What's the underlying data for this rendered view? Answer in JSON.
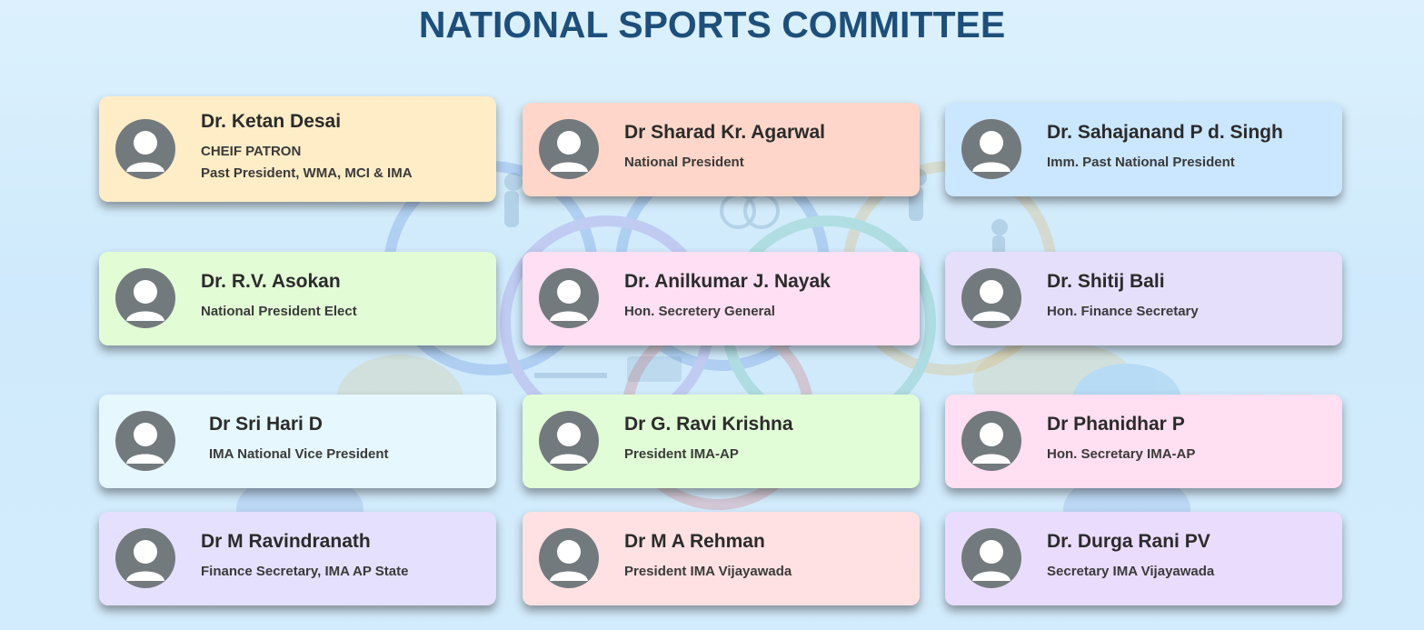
{
  "page": {
    "title": "NATIONAL SPORTS COMMITTEE"
  },
  "colors": {
    "title": "#1e4f7a",
    "avatar": "#737a7e",
    "background": "#d3ecfd"
  },
  "members": [
    {
      "name": "Dr. Ketan Desai",
      "roles": [
        "CHEIF PATRON",
        "Past President, WMA, MCI & IMA"
      ],
      "color": "#ffedc7"
    },
    {
      "name": "Dr Sharad Kr. Agarwal",
      "roles": [
        "National President"
      ],
      "color": "#ffd6c9"
    },
    {
      "name": "Dr. Sahajanand P d. Singh",
      "roles": [
        "Imm. Past National President"
      ],
      "color": "#cbe6ff"
    },
    {
      "name": "Dr. R.V. Asokan",
      "roles": [
        "National President Elect"
      ],
      "color": "#e2fcd6"
    },
    {
      "name": "Dr. Anilkumar J. Nayak",
      "roles": [
        "Hon. Secretery General"
      ],
      "color": "#ffdff3"
    },
    {
      "name": "Dr. Shitij Bali",
      "roles": [
        "Hon. Finance Secretary"
      ],
      "color": "#e6dffc"
    },
    {
      "name": "Dr Sri Hari D",
      "roles": [
        "IMA National Vice President"
      ],
      "color": "#e6f7fd"
    },
    {
      "name": "Dr G. Ravi Krishna",
      "roles": [
        "President IMA-AP"
      ],
      "color": "#e1fdd7"
    },
    {
      "name": "Dr Phanidhar P",
      "roles": [
        "Hon. Secretary IMA-AP"
      ],
      "color": "#ffdff1"
    },
    {
      "name": "Dr M Ravindranath",
      "roles": [
        "Finance Secretary, IMA AP State"
      ],
      "color": "#e5e0fd"
    },
    {
      "name": "Dr M A Rehman",
      "roles": [
        "President IMA Vijayawada"
      ],
      "color": "#ffe1e3"
    },
    {
      "name": "Dr. Durga Rani PV",
      "roles": [
        "Secretary IMA Vijayawada"
      ],
      "color": "#eadcfd"
    }
  ],
  "icons": {
    "avatar": "user-avatar-icon"
  }
}
